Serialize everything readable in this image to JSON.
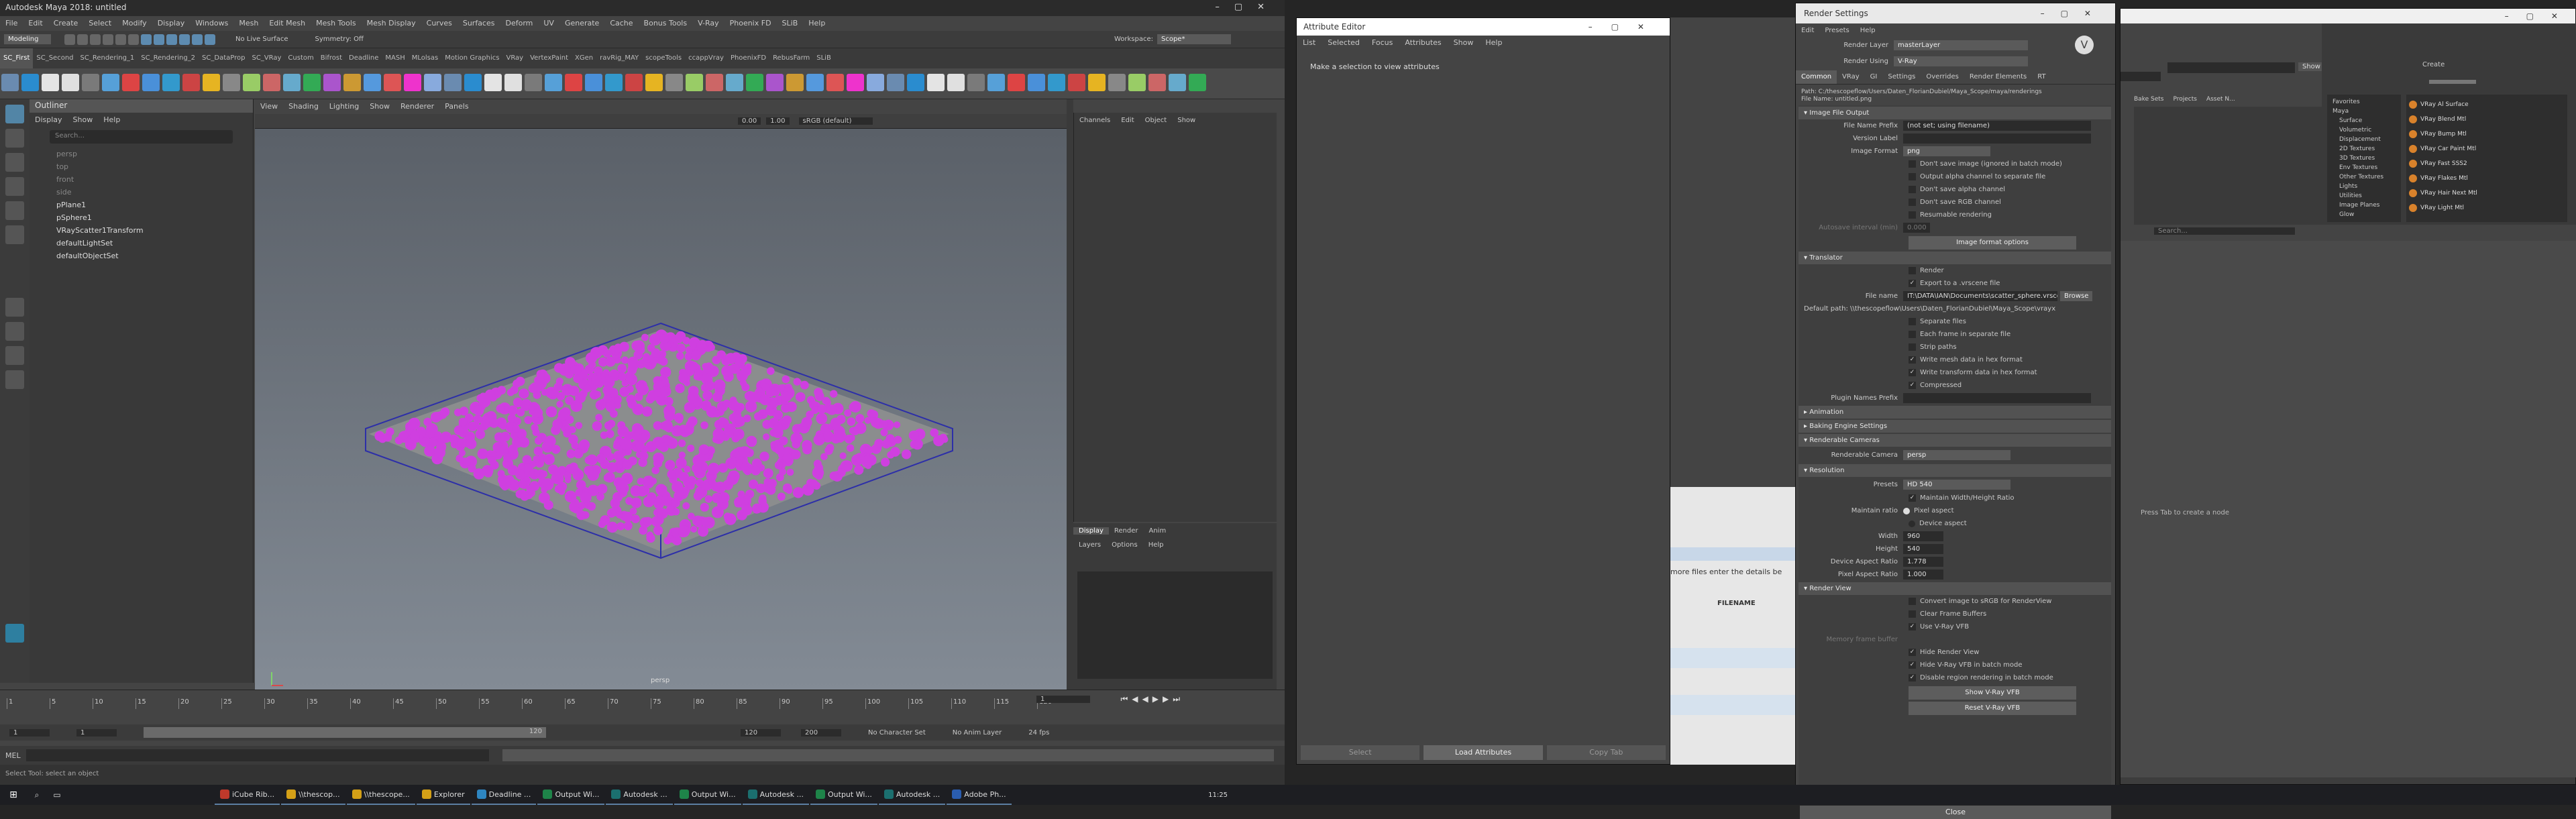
{
  "maya": {
    "title": "Autodesk Maya 2018: untitled",
    "menus": [
      "File",
      "Edit",
      "Create",
      "Select",
      "Modify",
      "Display",
      "Windows",
      "Mesh",
      "Edit Mesh",
      "Mesh Tools",
      "Mesh Display",
      "Curves",
      "Surfaces",
      "Deform",
      "UV",
      "Generate",
      "Cache",
      "Bonus Tools",
      "V-Ray",
      "Phoenix FD",
      "SLiB",
      "Help"
    ],
    "workspace_label": "Workspace:",
    "workspace_value": "Scope*",
    "mode": "Modeling",
    "symmetry": "Symmetry: Off",
    "live_surface": "No Live Surface",
    "shelf_tabs": [
      "SC_First",
      "SC_Second",
      "SC_Rendering_1",
      "SC_Rendering_2",
      "SC_DataProp",
      "SC_VRay",
      "Custom",
      "Bifrost",
      "Deadline",
      "MASH",
      "MLolsas",
      "Motion Graphics",
      "VRay",
      "VertexPaint",
      "XGen",
      "ravRig_MAY",
      "scopeTools",
      "ccappVray",
      "PhoenixFD",
      "RebusFarm",
      "SLiB"
    ],
    "outliner": {
      "title": "Outliner",
      "menus": [
        "Display",
        "Show",
        "Help"
      ],
      "search_placeholder": "Search...",
      "items": [
        "persp",
        "top",
        "front",
        "side",
        "pPlane1",
        "pSphere1",
        "VRayScatter1Transform",
        "defaultLightSet",
        "defaultObjectSet"
      ],
      "dim_items": [
        true,
        true,
        true,
        true,
        false,
        false,
        false,
        false,
        false
      ]
    },
    "viewport": {
      "menus": [
        "View",
        "Shading",
        "Lighting",
        "Show",
        "Renderer",
        "Panels"
      ],
      "camera_label": "persp",
      "field_a": "0.00",
      "field_b": "1.00",
      "color_space": "sRGB (default)"
    },
    "channelbox": {
      "menus": [
        "Channels",
        "Edit",
        "Object",
        "Show"
      ]
    },
    "layers": {
      "tabs": [
        "Display",
        "Render",
        "Anim"
      ],
      "menus": [
        "Layers",
        "Options",
        "Help"
      ]
    },
    "timeline": {
      "ticks": [
        "1",
        "5",
        "10",
        "15",
        "20",
        "25",
        "30",
        "35",
        "40",
        "45",
        "50",
        "55",
        "60",
        "65",
        "70",
        "75",
        "80",
        "85",
        "90",
        "95",
        "100",
        "105",
        "110",
        "115",
        "120"
      ],
      "current_frame": "1"
    },
    "range": {
      "start": "1",
      "start2": "1",
      "end_inner": "120",
      "end": "120",
      "end2": "200",
      "character_set": "No Character Set",
      "anim_layer": "No Anim Layer",
      "fps": "24 fps",
      "slider_val": "120"
    },
    "mel_label": "MEL",
    "help_line": "Select Tool: select an object"
  },
  "attribute_editor": {
    "title": "Attribute Editor",
    "menus": [
      "List",
      "Selected",
      "Focus",
      "Attributes",
      "Show",
      "Help"
    ],
    "message": "Make a selection to view attributes",
    "buttons": [
      "Select",
      "Load Attributes",
      "Copy Tab"
    ]
  },
  "web_bg": {
    "text1": "more files enter the details be",
    "col": "FILENAME"
  },
  "render_settings": {
    "title": "Render Settings",
    "menus": [
      "Edit",
      "Presets",
      "Help"
    ],
    "render_layer_label": "Render Layer",
    "render_layer": "masterLayer",
    "render_using_label": "Render Using",
    "render_using": "V-Ray",
    "tabs": [
      "Common",
      "VRay",
      "GI",
      "Settings",
      "Overrides",
      "Render Elements",
      "RT"
    ],
    "path": "Path: C:/thescopeflow/Users/Daten_FlorianDubiel/Maya_Scope/maya/renderings",
    "file_name": "File Name: untitled.png",
    "sections": {
      "image_file_output": "Image File Output",
      "translator": "Translator",
      "animation": "Animation",
      "baking": "Baking Engine Settings",
      "cameras": "Renderable Cameras",
      "resolution": "Resolution",
      "render_view": "Render View"
    },
    "file_name_prefix_label": "File Name Prefix",
    "file_name_prefix": "(not set; using filename)",
    "version_label": "Version Label",
    "image_format_label": "Image Format",
    "image_format": "png",
    "output_checks": [
      {
        "label": "Don't save image (ignored in batch mode)",
        "on": false
      },
      {
        "label": "Output alpha channel to separate file",
        "on": false
      },
      {
        "label": "Don't save alpha channel",
        "on": false
      },
      {
        "label": "Don't save RGB channel",
        "on": false
      },
      {
        "label": "Resumable rendering",
        "on": false
      }
    ],
    "autosave_label": "Autosave interval (min)",
    "autosave_value": "0.000",
    "image_format_options": "Image format options",
    "translator_checks": [
      {
        "label": "Render",
        "on": false
      },
      {
        "label": "Export to a .vrscene file",
        "on": true
      }
    ],
    "file_name_label": "File name",
    "file_name_value": "IT:\\DATA\\IAN\\Documents\\scatter_sphere.vrscene",
    "browse": "Browse",
    "default_path": "Default path: \\\\thescopeflow\\Users\\Daten_FlorianDubiel\\Maya_Scope\\vrayx",
    "translator_checks2": [
      {
        "label": "Separate files",
        "on": false
      },
      {
        "label": "Each frame in separate file",
        "on": false
      },
      {
        "label": "Strip paths",
        "on": false
      },
      {
        "label": "Write mesh data in hex format",
        "on": true
      },
      {
        "label": "Write transform data in hex format",
        "on": true
      },
      {
        "label": "Compressed",
        "on": true
      }
    ],
    "plugin_prefix_label": "Plugin Names Prefix",
    "renderable_camera_label": "Renderable Camera",
    "renderable_camera": "persp",
    "presets_label": "Presets",
    "presets": "HD 540",
    "maintain_wh": "Maintain Width/Height Ratio",
    "maintain_ratio_label": "Maintain ratio",
    "pixel_aspect": "Pixel aspect",
    "device_aspect": "Device aspect",
    "width_label": "Width",
    "width": "960",
    "height_label": "Height",
    "height": "540",
    "dar_label": "Device Aspect Ratio",
    "dar": "1.778",
    "par_label": "Pixel Aspect Ratio",
    "par": "1.000",
    "rv_checks": [
      {
        "label": "Convert image to sRGB for RenderView",
        "on": false
      },
      {
        "label": "Clear Frame Buffers",
        "on": false
      },
      {
        "label": "Use V-Ray VFB",
        "on": true
      }
    ],
    "memory_label": "Memory frame buffer",
    "rv_checks2": [
      {
        "label": "Hide Render View",
        "on": true
      },
      {
        "label": "Hide V-Ray VFB in batch mode",
        "on": true
      },
      {
        "label": "Disable region rendering in batch mode",
        "on": true
      }
    ],
    "show_vfb": "Show V-Ray VFB",
    "reset_vfb": "Reset V-Ray VFB",
    "close": "Close"
  },
  "hypershade": {
    "show_btn": "Show",
    "tree": [
      "Favorites",
      "Maya",
      "Surface",
      "Volumetric",
      "Displacement",
      "2D Textures",
      "3D Textures",
      "Env Textures",
      "Other Textures",
      "Lights",
      "Utilities",
      "Image Planes",
      "Glow"
    ],
    "create_label": "Create",
    "materials": [
      "VRay Al Surface",
      "VRay Blend Mtl",
      "VRay Bump Mtl",
      "VRay Car Paint Mtl",
      "VRay Fast SSS2",
      "VRay Flakes Mtl",
      "VRay Hair Next Mtl",
      "VRay Light Mtl"
    ],
    "tabs_small": [
      "Bake Sets",
      "Projects",
      "Asset N..."
    ],
    "search_placeholder": "Search...",
    "empty_msg": "Press Tab to create a node"
  },
  "taskbar": {
    "apps": [
      "iCube Rib...",
      "\\\\thescop...",
      "\\\\thescope...",
      "Explorer",
      "Deadline ...",
      "Output Wi...",
      "Autodesk ...",
      "Output Wi...",
      "Autodesk ...",
      "Output Wi...",
      "Autodesk ...",
      "Adobe Ph..."
    ],
    "app_colors": [
      "#c0392b",
      "#d4a017",
      "#d4a017",
      "#d4a017",
      "#2e86c1",
      "#1e8449",
      "#1b6f6f",
      "#1e8449",
      "#1b6f6f",
      "#1e8449",
      "#1b6f6f",
      "#2a5db0"
    ],
    "time": "11:25"
  }
}
